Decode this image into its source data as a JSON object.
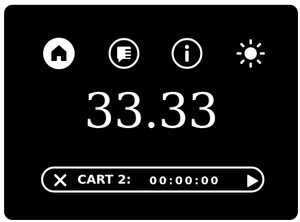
{
  "toolbar": {
    "icons": [
      "home-icon",
      "feedback-icon",
      "info-icon",
      "brightness-icon"
    ]
  },
  "display": {
    "value": "33.33"
  },
  "cart": {
    "label": "CART 2:",
    "time": "00:00:00"
  },
  "colors": {
    "background": "#000000",
    "foreground": "#ffffff"
  }
}
